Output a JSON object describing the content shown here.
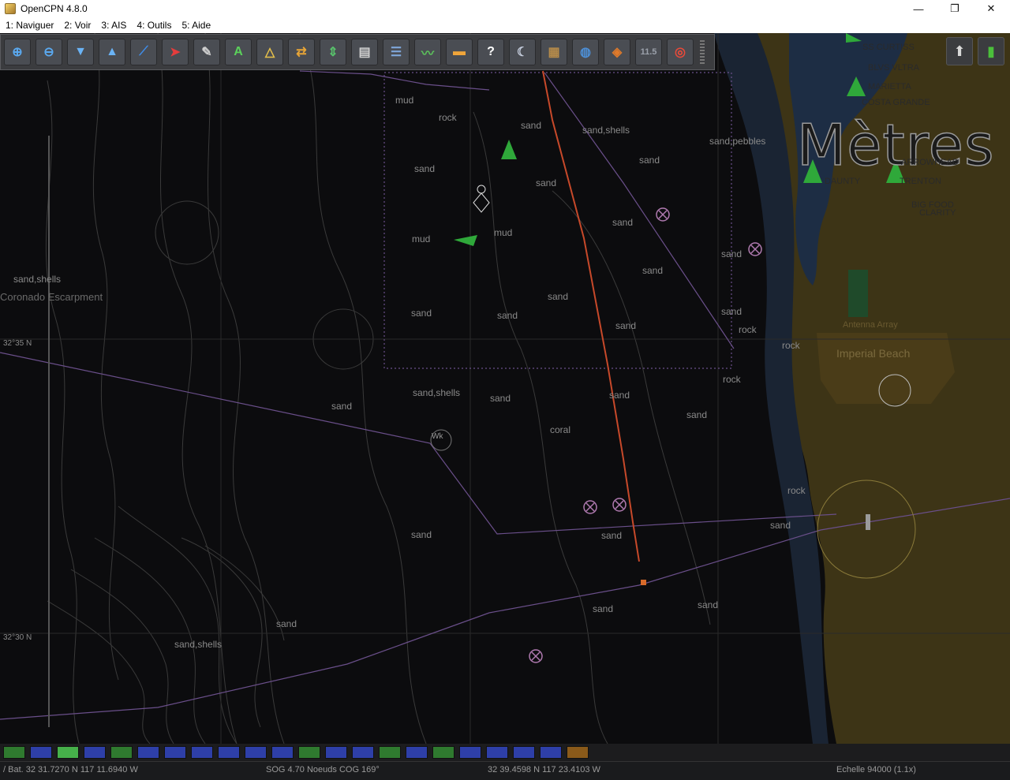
{
  "window": {
    "title": "OpenCPN 4.8.0",
    "controls": [
      "—",
      "❐",
      "✕"
    ]
  },
  "menu": [
    "1: Naviguer",
    "2: Voir",
    "3: AIS",
    "4: Outils",
    "5: Aide"
  ],
  "toolbar": {
    "buttons": [
      {
        "icon": "zoom-in-icon",
        "glyph": "⊕",
        "color": "#5aa9f0"
      },
      {
        "icon": "zoom-out-icon",
        "glyph": "⊖",
        "color": "#5aa9f0"
      },
      {
        "icon": "scale-in-icon",
        "glyph": "▼",
        "color": "#6ab3f5"
      },
      {
        "icon": "scale-out-icon",
        "glyph": "▲",
        "color": "#6ab3f5"
      },
      {
        "icon": "route-icon",
        "glyph": "⟋",
        "color": "#3f8ce8"
      },
      {
        "icon": "auto-follow-icon",
        "glyph": "➤",
        "color": "#e53c3c"
      },
      {
        "icon": "settings-icon",
        "glyph": "✎",
        "color": "#cfcfcf"
      },
      {
        "icon": "text-icon",
        "glyph": "A",
        "color": "#5bd15b"
      },
      {
        "icon": "tide-icon",
        "glyph": "△",
        "color": "#e6c04a"
      },
      {
        "icon": "current-icon",
        "glyph": "⇄",
        "color": "#e6a437"
      },
      {
        "icon": "measure-icon",
        "glyph": "⇕",
        "color": "#58c06b"
      },
      {
        "icon": "print-icon",
        "glyph": "▤",
        "color": "#d0d0d0"
      },
      {
        "icon": "route-manager-icon",
        "glyph": "☰",
        "color": "#7fa6d9"
      },
      {
        "icon": "track-icon",
        "glyph": "〰",
        "color": "#5bbf5b"
      },
      {
        "icon": "color-scheme-icon",
        "glyph": "▬",
        "color": "#f0a53a"
      },
      {
        "icon": "help-icon",
        "glyph": "?",
        "color": "#ffffff"
      },
      {
        "icon": "night-icon",
        "glyph": "☾",
        "color": "#c8d0e0"
      },
      {
        "icon": "chart-quilt-icon",
        "glyph": "▦",
        "color": "#b48a4a"
      },
      {
        "icon": "globe-icon",
        "glyph": "◍",
        "color": "#4d8fd6"
      },
      {
        "icon": "radar-icon",
        "glyph": "◈",
        "color": "#e07a2a"
      },
      {
        "icon": "dashboard-icon",
        "glyph": "11.5",
        "color": "#9aa0aa"
      },
      {
        "icon": "lifebuoy-icon",
        "glyph": "◎",
        "color": "#e84a3a"
      }
    ]
  },
  "right_tools": [
    {
      "icon": "compass-icon",
      "glyph": "⬆",
      "color": "#d8d8d8"
    },
    {
      "icon": "signal-icon",
      "glyph": "▮",
      "color": "#4bbf3b"
    }
  ],
  "units_label": "Mètres",
  "labels": {
    "escarpment": "Coronado Escarpment",
    "lat_35": "32°35 N",
    "lat_30": "32°30 N",
    "imperial_beach": "Imperial Beach",
    "antenna": "Antenna Array",
    "ships": [
      "SS CURTISS",
      "BLVS VLTRA",
      "MARIETTA",
      "COSTA GRANDE",
      "ARROWHEAD",
      "DAUNTY",
      "TRENTON",
      "BIG FOOD",
      "CLARITY"
    ],
    "seabed": [
      "mud",
      "rock",
      "sand",
      "sand",
      "sand",
      "sand",
      "sand,shells",
      "sand,pebbles",
      "sand",
      "sand",
      "sand",
      "sand",
      "sand",
      "sand",
      "rock",
      "rock",
      "rock",
      "sand,shells",
      "sand",
      "coral",
      "sand",
      "sand",
      "sand",
      "sand",
      "sand",
      "sand,shells",
      "sand",
      "sand",
      "mud",
      "mud",
      "sand,shells",
      "sand",
      "sand",
      "rock",
      "sand",
      "sand"
    ],
    "wreck": "Wk"
  },
  "piano": [
    "#2f7a2f",
    "#2e3fa8",
    "#46b04a",
    "#2e3fa8",
    "#2f7a2f",
    "#2e3fa8",
    "#2e3fa8",
    "#2e3fa8",
    "#2e3fa8",
    "#2e3fa8",
    "#2e3fa8",
    "#2f7a2f",
    "#2e3fa8",
    "#2e3fa8",
    "#2f7a2f",
    "#2e3fa8",
    "#2f7a2f",
    "#2e3fa8",
    "#2e3fa8",
    "#2e3fa8",
    "#2e3fa8",
    "#8a5a1a"
  ],
  "status": {
    "ship_position": "/ Bat. 32 31.7270 N   117 11.6940 W",
    "sog_cog": "SOG 4.70 Noeuds  COG 169°",
    "cursor_position": "32 39.4598 N   117 23.4103 W",
    "scale": "Echelle 94000 (1.1x)"
  },
  "colors": {
    "sea": "#0c0c0e",
    "land": "#3f3515",
    "shallow": "#1c2a3c",
    "route": "#c7492a",
    "boundary": "#6a4f8a"
  }
}
